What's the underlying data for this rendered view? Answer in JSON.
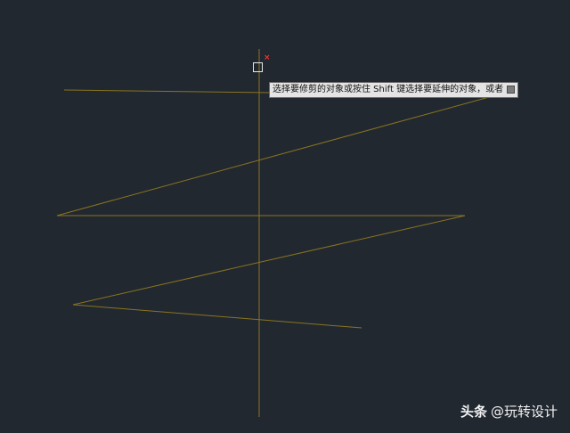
{
  "tooltip": {
    "prompt_text": "选择要修剪的对象或按住 Shift 键选择要延伸的对象，或者"
  },
  "watermark": {
    "brand": "头条",
    "author": "@玩转设计"
  },
  "colors": {
    "background": "#212830",
    "geometry": "#8a7420",
    "pickbox": "#e8e8e8",
    "cursor_mark": "#ff3030",
    "tooltip_bg": "#e4e4e4"
  },
  "icons": {
    "cursor_mark": "cross-icon",
    "tooltip_option": "options-icon"
  }
}
